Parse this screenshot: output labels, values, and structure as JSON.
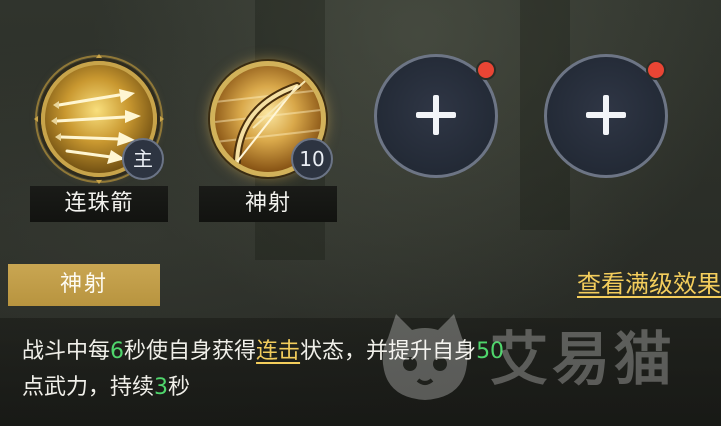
{
  "skills": [
    {
      "name": "连珠箭",
      "badge": "主",
      "icon": "multi-arrow-icon"
    },
    {
      "name": "神射",
      "badge": "10",
      "icon": "bow-icon"
    }
  ],
  "add_slots": [
    {
      "icon": "plus-icon",
      "has_notification": true
    },
    {
      "icon": "plus-icon",
      "has_notification": true
    }
  ],
  "detail": {
    "title": "神射",
    "view_max_label": "查看满级效果",
    "desc": {
      "p1": "战斗中每",
      "n1": "6",
      "p2": "秒使自身获得",
      "keyword": "连击",
      "p3": "状态，并提升自身",
      "n2": "50",
      "p4": "点武力，持续",
      "n3": "3",
      "p5": "秒"
    }
  },
  "watermark": {
    "text": "艾易猫",
    "icon": "cat-logo-icon"
  },
  "colors": {
    "accent_gold": "#f3cd5c",
    "tab_gold": "#c9a652",
    "number_green": "#4fd66c",
    "notification_red": "#e94534"
  }
}
